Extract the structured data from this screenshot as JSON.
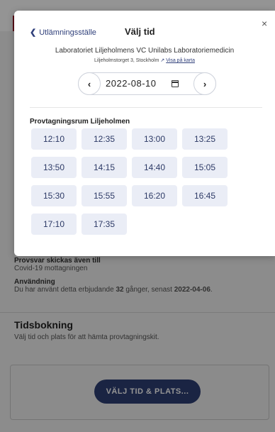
{
  "background": {
    "provsvar_label": "Provsvar skickas även till",
    "provsvar_value": "Covid-19 mottagningen",
    "anvandning_label": "Användning",
    "anvandning_prefix": "Du har använt detta erbjudande ",
    "anvandning_count": "32",
    "anvandning_middle": " gånger, senast ",
    "anvandning_date": "2022-04-06",
    "anvandning_suffix": ".",
    "tidsbokning_title": "Tidsbokning",
    "tidsbokning_text": "Välj tid och plats för att hämta provtagningskit.",
    "button_label": "VÄLJ TID & PLATS..."
  },
  "modal": {
    "back_label": "Utlämningsställe",
    "title": "Välj tid",
    "close_glyph": "×",
    "lab_name": "Laboratoriet Liljeholmens VC Unilabs Laboratoriemedicin",
    "lab_address": "Liljeholmstorget 3, Stockholm",
    "map_link": "Visa på karta",
    "date": "2022-08-10",
    "room_title": "Provtagningsrum Liljeholmen",
    "slots": [
      "12:10",
      "12:35",
      "13:00",
      "13:25",
      "13:50",
      "14:15",
      "14:40",
      "15:05",
      "15:30",
      "15:55",
      "16:20",
      "16:45",
      "17:10",
      "17:35"
    ]
  },
  "icons": {
    "back": "chevron-left-icon",
    "close": "close-icon",
    "prev": "chevron-left-icon",
    "next": "chevron-right-icon",
    "calendar": "calendar-icon",
    "external": "external-link-icon"
  },
  "colors": {
    "primary": "#2e3e74",
    "slot_bg": "#eaedf6",
    "slot_text": "#2d3a66",
    "brand_red": "#9b1b2a"
  }
}
